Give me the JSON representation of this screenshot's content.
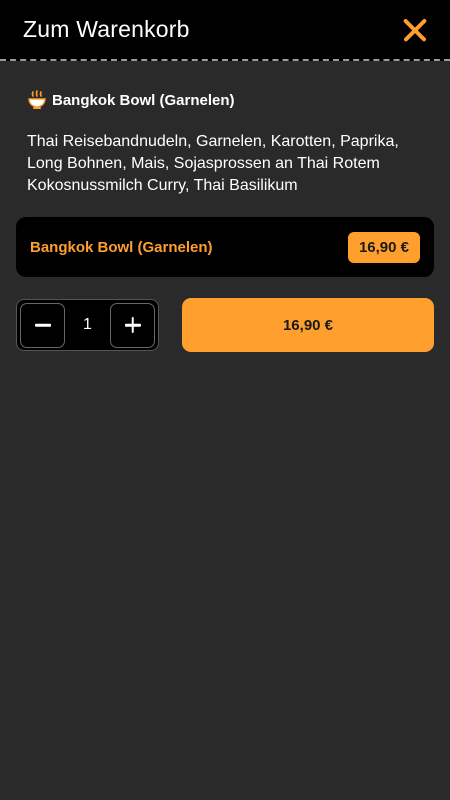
{
  "header": {
    "title": "Zum Warenkorb",
    "close_icon": "close-icon"
  },
  "product": {
    "icon": "bowl-icon",
    "name": "Bangkok Bowl (Garnelen)",
    "description": "Thai Reisebandnudeln, Garnelen, Karotten, Paprika, Long Bohnen, Mais, Sojasprossen an Thai Rotem Kokosnussmilch Curry, Thai Basilikum"
  },
  "variant": {
    "name": "Bangkok Bowl (Garnelen)",
    "price": "16,90 €"
  },
  "quantity": {
    "value": "1",
    "decrement_icon": "minus-icon",
    "increment_icon": "plus-icon"
  },
  "cart_button": {
    "label": "16,90 €"
  },
  "colors": {
    "accent": "#ff9f2e",
    "background": "#2a2a2a",
    "header_bg": "#000000",
    "card_bg": "#000000"
  }
}
